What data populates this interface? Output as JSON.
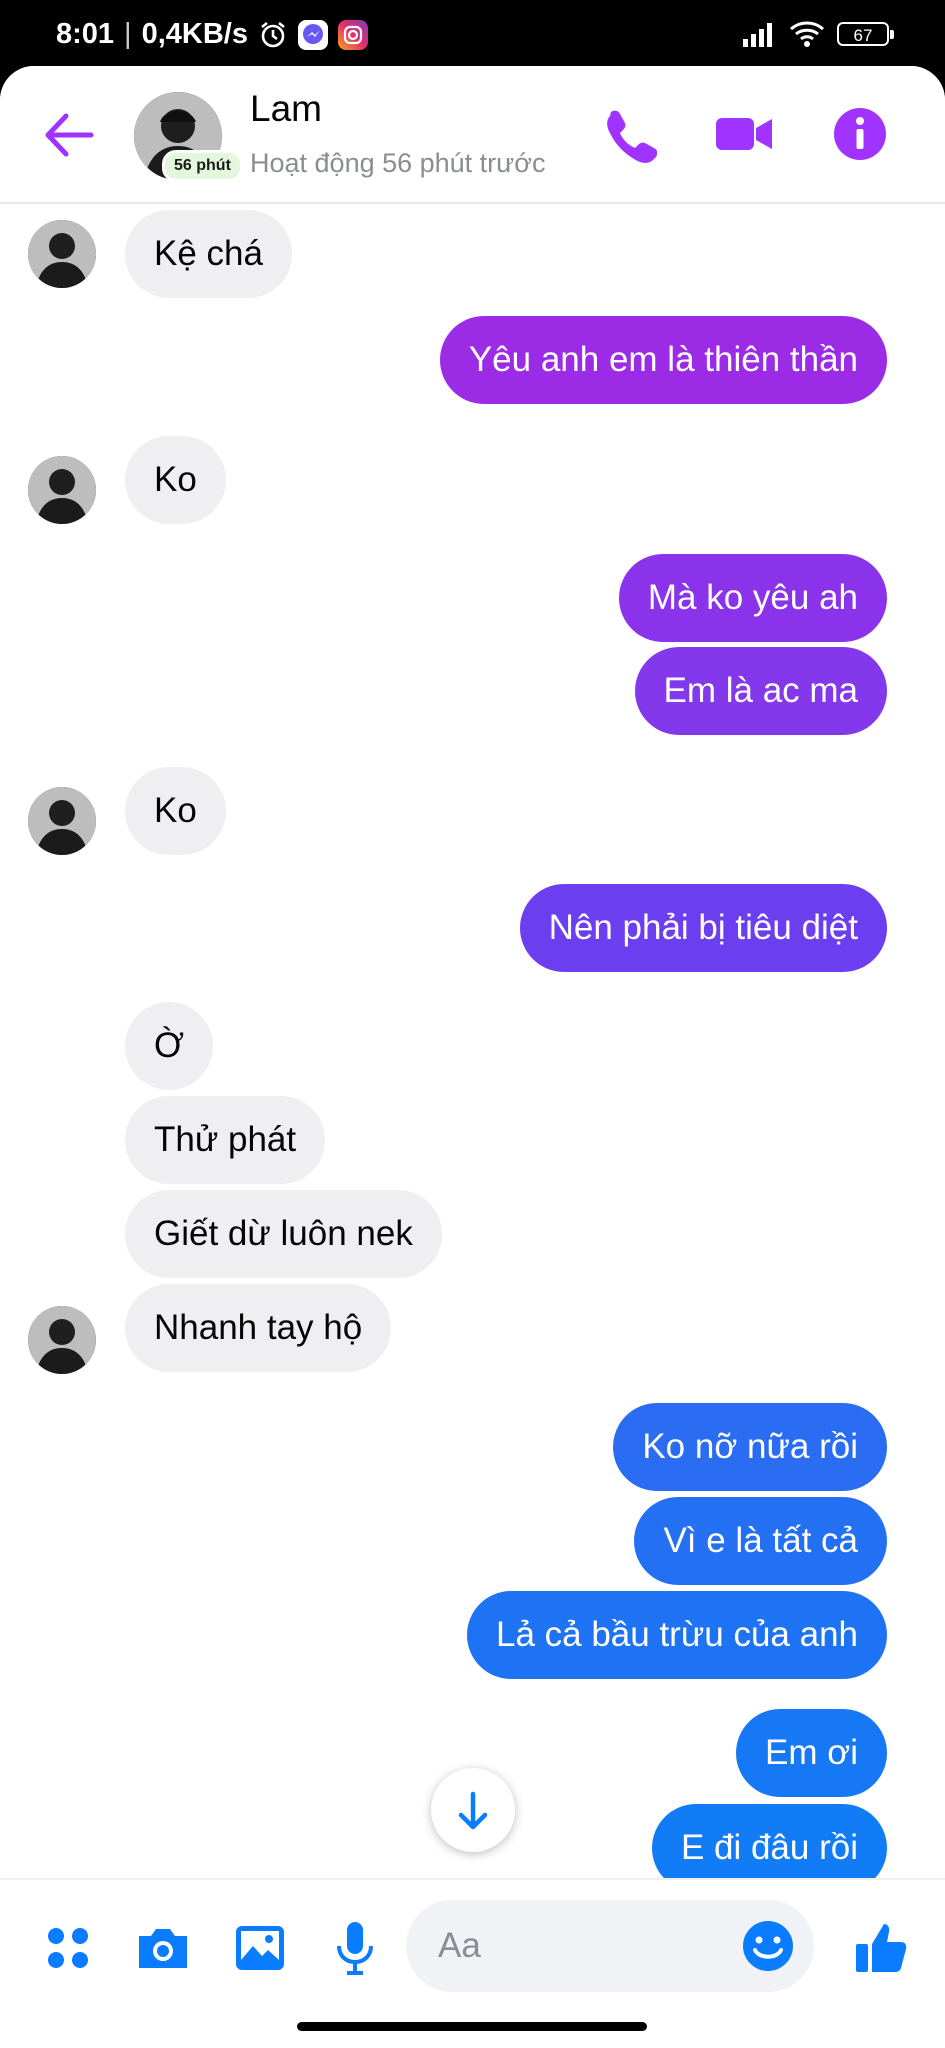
{
  "status_bar": {
    "time": "8:01",
    "net_speed": "0,4KB/s",
    "battery": "67",
    "icons": [
      "alarm-icon",
      "messenger-app-icon",
      "instagram-app-icon",
      "signal-icon",
      "wifi-icon",
      "battery-icon"
    ]
  },
  "header": {
    "contact_name": "Lam",
    "active_badge": "56 phút",
    "status": "Hoạt động 56 phút trước",
    "icons": [
      "back-arrow-icon",
      "phone-icon",
      "video-camera-icon",
      "info-icon"
    ],
    "accent_color": "#a033ff"
  },
  "messages": [
    {
      "side": "in",
      "text": "Kệ chá",
      "avatar": true
    },
    {
      "side": "out",
      "text": "Yêu anh em là thiên thần",
      "color": "#9c2be6"
    },
    {
      "side": "in",
      "text": "Ko",
      "avatar": true
    },
    {
      "side": "out",
      "text": "Mà ko yêu ah",
      "color": "#8a33ea"
    },
    {
      "side": "out",
      "text": "Em là ac ma",
      "color": "#8438ec"
    },
    {
      "side": "in",
      "text": "Ko",
      "avatar": true
    },
    {
      "side": "out",
      "text": "Nên phải bị tiêu diệt",
      "color": "#6b3ff0"
    },
    {
      "side": "in",
      "text": "Ờ",
      "avatar": false
    },
    {
      "side": "in",
      "text": "Thử phát",
      "avatar": false
    },
    {
      "side": "in",
      "text": "Giết dừ luôn nek",
      "avatar": false
    },
    {
      "side": "in",
      "text": "Nhanh tay hộ",
      "avatar": true
    },
    {
      "side": "out",
      "text": "Ko nỡ nữa rồi",
      "color": "#2a6cf2"
    },
    {
      "side": "out",
      "text": "Vì e là tất cả",
      "color": "#2370f3"
    },
    {
      "side": "out",
      "text": "Lả cả bầu trừu của anh",
      "color": "#1d73f4"
    },
    {
      "side": "out",
      "text": "Em ơi",
      "color": "#1778f5"
    },
    {
      "side": "out",
      "text": "E đi đâu rồi",
      "color": "#127bf6"
    }
  ],
  "composer": {
    "placeholder": "Aa",
    "icons": [
      "menu-dots-icon",
      "camera-icon",
      "image-icon",
      "microphone-icon",
      "emoji-icon",
      "thumbs-up-icon"
    ],
    "accent_color": "#0a7cff"
  }
}
